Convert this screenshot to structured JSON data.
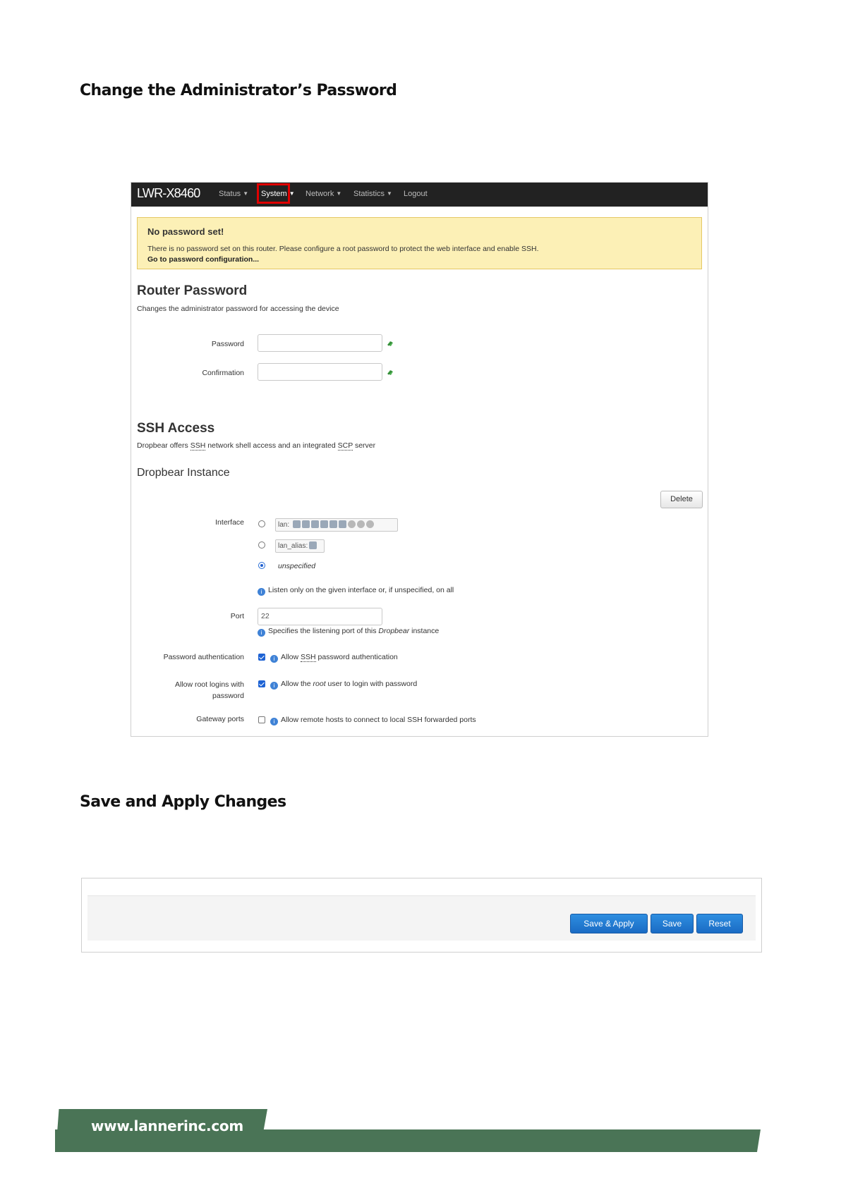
{
  "heading_change_password": "Change the Administrator’s Password",
  "heading_save_apply": "Save and Apply Changes",
  "nav": {
    "brand": "LWR-X8460",
    "items": [
      "Status",
      "System",
      "Network",
      "Statistics",
      "Logout"
    ],
    "highlighted": "System",
    "highlight_color": "#e00000"
  },
  "alert": {
    "title": "No password set!",
    "text": "There is no password set on this router. Please configure a root password to protect the web interface and enable SSH.",
    "link": "Go to password configuration..."
  },
  "router_password": {
    "title": "Router Password",
    "description": "Changes the administrator password for accessing the device",
    "password_label": "Password",
    "confirmation_label": "Confirmation",
    "password_value": "",
    "confirmation_value": ""
  },
  "ssh": {
    "title": "SSH Access",
    "desc_part1": "Dropbear offers ",
    "desc_ssh": "SSH",
    "desc_part2": " network shell access and an integrated ",
    "desc_scp": "SCP",
    "desc_part3": " server",
    "instance_title": "Dropbear Instance",
    "delete_label": "Delete",
    "interface_label": "Interface",
    "interfaces": [
      "lan:",
      "lan_alias:"
    ],
    "unspecified": "unspecified",
    "selected_interface": "unspecified",
    "interface_note": "Listen only on the given interface or, if unspecified, on all",
    "port_label": "Port",
    "port_value": "22",
    "port_note_part1": "Specifies the listening port of this ",
    "port_note_em": "Dropbear",
    "port_note_part2": " instance",
    "pwauth_label": "Password authentication",
    "pwauth_checked": true,
    "pwauth_note_part1": "Allow ",
    "pwauth_note_ssh": "SSH",
    "pwauth_note_part2": " password authentication",
    "root_label_line1": "Allow root logins with",
    "root_label_line2": "password",
    "root_checked": true,
    "root_note_part1": "Allow the ",
    "root_note_em": "root",
    "root_note_part2": " user to login with password",
    "gateway_label": "Gateway ports",
    "gateway_checked": false,
    "gateway_note": "Allow remote hosts to connect to local SSH forwarded ports"
  },
  "actions": {
    "save_apply": "Save & Apply",
    "save": "Save",
    "reset": "Reset"
  },
  "footer": {
    "url": "www.lannerinc.com",
    "color": "#4a7456"
  }
}
